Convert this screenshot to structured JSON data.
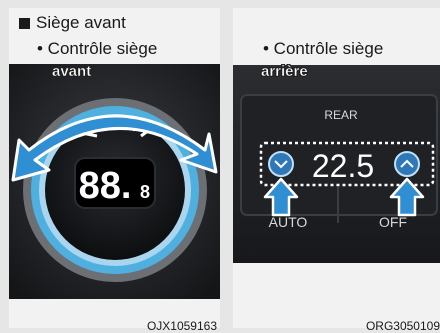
{
  "section": {
    "title": "Siège avant"
  },
  "left": {
    "bullet": "• Contrôle siège",
    "overlay": "avant",
    "display": "88.",
    "display_small": "8",
    "code": "OJX1059163"
  },
  "right": {
    "bullet": "• Contrôle siège",
    "overlay": "arrière",
    "rear_label": "REAR",
    "temperature": "22.5",
    "auto_label": "AUTO",
    "off_label": "OFF",
    "code": "ORG3050109"
  },
  "colors": {
    "arrow_blue": "#2f8fd2",
    "knob_ring": "#4fb0e0",
    "dashed_box": "#ffffff"
  }
}
